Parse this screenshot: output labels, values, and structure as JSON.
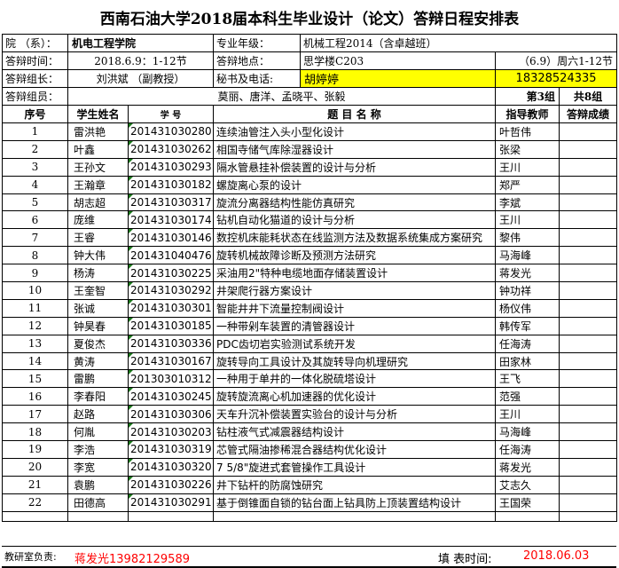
{
  "title": "西南石油大学2018届本科生毕业设计（论文）答辩日程安排表",
  "info": {
    "college_label": "院  （系）：",
    "college_value": "机电工程学院",
    "major_label": "专业年级：",
    "major_value": "机械工程2014（含卓越班）",
    "time_label": "答辩时间：",
    "time_value": "2018.6.9：1-12节",
    "place_label": "答辩地点：",
    "place_value": "思学楼C203",
    "schedule_value": "（6.9）周六1-12节",
    "leader_label": "答辩组长：",
    "leader_value": "刘洪斌  （副教授）",
    "secretary_label": "秘书及电话:",
    "secretary_name": "胡婷婷",
    "secretary_phone": "18328524335",
    "members_label": "答辩组员：",
    "members_value": "莫丽、唐洋、孟晓平、张毅",
    "group_value": "第3组",
    "total_value": "共8组"
  },
  "colors": {
    "highlight": "#ffff00",
    "accent_red": "#ff0000",
    "cell_marker": "#1a7a1a"
  },
  "table": {
    "headers": [
      "序号",
      "学生姓名",
      "学  号",
      "题  目  名  称",
      "指导教师",
      "答辩成绩"
    ],
    "rows": [
      {
        "no": "1",
        "name": "雷洪艳",
        "id": "201431030280",
        "topic": "连续油管注入头小型化设计",
        "advisor": "叶哲伟",
        "score": ""
      },
      {
        "no": "2",
        "name": "叶鑫",
        "id": "201431030262",
        "topic": "相国寺储气库除湿器设计",
        "advisor": "张梁",
        "score": ""
      },
      {
        "no": "3",
        "name": "王孙文",
        "id": "201431030293",
        "topic": "隔水管悬挂补偿装置的设计与分析",
        "advisor": "王川",
        "score": ""
      },
      {
        "no": "4",
        "name": "王瀚章",
        "id": "201431030182",
        "topic": "螺旋离心泵的设计",
        "advisor": "郑严",
        "score": ""
      },
      {
        "no": "5",
        "name": "胡志超",
        "id": "201431030317",
        "topic": "旋流分离器结构性能仿真研究",
        "advisor": "李斌",
        "score": ""
      },
      {
        "no": "6",
        "name": "庞维",
        "id": "201431030174",
        "topic": "钻机自动化猫道的设计与分析",
        "advisor": "王川",
        "score": ""
      },
      {
        "no": "7",
        "name": "王睿",
        "id": "201431030146",
        "topic": "数控机床能耗状态在线监测方法及数据系统集成方案研究",
        "advisor": "黎伟",
        "score": ""
      },
      {
        "no": "8",
        "name": "钟大伟",
        "id": "201431040476",
        "topic": "旋转机械故障诊断及预测方法研究",
        "advisor": "马海峰",
        "score": ""
      },
      {
        "no": "9",
        "name": "杨涛",
        "id": "201431030225",
        "advisor": "蒋发光",
        "topic": "采油用2\"特种电缆地面存储装置设计",
        "score": ""
      },
      {
        "no": "10",
        "name": "王奎智",
        "id": "201431030292",
        "topic": "井架爬行器方案设计",
        "advisor": "钟功祥",
        "score": ""
      },
      {
        "no": "11",
        "name": "张诚",
        "id": "201431030301",
        "topic": "智能井井下流量控制阀设计",
        "advisor": "杨仪伟",
        "score": ""
      },
      {
        "no": "12",
        "name": "钟昊春",
        "id": "201431030185",
        "topic": "一种带剁车装置的清管器设计",
        "advisor": "韩传军",
        "score": ""
      },
      {
        "no": "13",
        "name": "夏俊杰",
        "id": "201431030336",
        "topic": "PDC齿切岩实验测试系统开发",
        "advisor": "任海涛",
        "score": ""
      },
      {
        "no": "14",
        "name": "黄涛",
        "id": "201431030167",
        "topic": "旋转导向工具设计及其旋转导向机理研究",
        "advisor": "田家林",
        "score": ""
      },
      {
        "no": "15",
        "name": "雷鹏",
        "id": "201303010312",
        "topic": "一种用于单井的一体化脱硫塔设计",
        "advisor": "王飞",
        "score": ""
      },
      {
        "no": "16",
        "name": "李春阳",
        "id": "201431030245",
        "topic": "旋转旋流离心机加速器的优化设计",
        "advisor": "范强",
        "score": ""
      },
      {
        "no": "17",
        "name": "赵路",
        "id": "201431030306",
        "topic": "天车升沉补偿装置实验台的设计与分析",
        "advisor": "王川",
        "score": ""
      },
      {
        "no": "18",
        "name": "何胤",
        "id": "201431030203",
        "topic": "钻柱液气式减震器结构设计",
        "advisor": "马海峰",
        "score": ""
      },
      {
        "no": "19",
        "name": "李浩",
        "id": "201431030319",
        "topic": "芯管式隔油掺稀混合器结构优化设计",
        "advisor": "任海涛",
        "score": ""
      },
      {
        "no": "20",
        "name": "李宽",
        "id": "201431030320",
        "topic": "7 5/8\"旋进式套管操作工具设计",
        "advisor": "蒋发光",
        "score": ""
      },
      {
        "no": "21",
        "name": "袁鹏",
        "id": "201431030226",
        "topic": "井下钻杆的防腐蚀研究",
        "advisor": "艾志久",
        "score": ""
      },
      {
        "no": "22",
        "name": "田德高",
        "id": "201431030291",
        "topic": "基于倒锥面自锁的钻台面上钻具防上顶装置结构设计",
        "advisor": "王国荣",
        "score": ""
      }
    ]
  },
  "footer": {
    "office_label": "教研室负责:",
    "office_value": "蒋发光13982129589",
    "filled_label": "填  表时间:",
    "filled_value": "2018.06.03"
  }
}
